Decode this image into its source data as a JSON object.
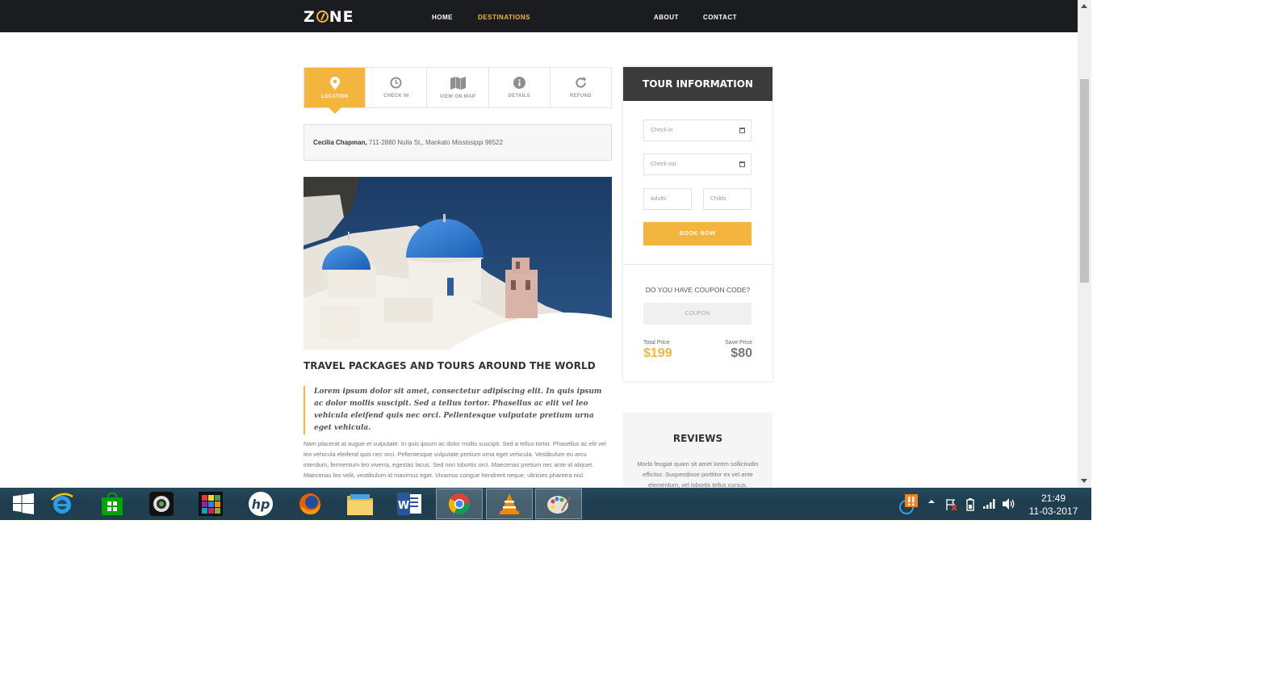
{
  "site": {
    "logo": "ZONE",
    "logo_left": "Z",
    "logo_right": "NE",
    "nav": {
      "home": "HOME",
      "destinations": "DESTINATIONS",
      "about": "ABOUT",
      "contact": "CONTACT"
    }
  },
  "tabs": [
    {
      "label": "LOCATION",
      "icon": "map-pin-icon",
      "active": true
    },
    {
      "label": "CHECK IN",
      "icon": "clock-icon",
      "active": false
    },
    {
      "label": "VIEW ON MAP",
      "icon": "map-icon",
      "active": false
    },
    {
      "label": "DETAILS",
      "icon": "info-icon",
      "active": false
    },
    {
      "label": "REFUND",
      "icon": "refresh-icon",
      "active": false
    }
  ],
  "address": {
    "name": "Cecilia Chapman,",
    "street": " 711-2880 Nulla St., Mankato Mississippi 96522"
  },
  "content": {
    "heading": "TRAVEL PACKAGES AND TOURS AROUND THE WORLD",
    "quote": "Lorem ipsum dolor sit amet, consectetur adipiscing elit. In quis ipsum ac dolor mollis suscipit. Sed a tellus tortor. Phasellus ac elit vel leo vehicula eleifend quis nec orci. Pellentesque vulputate pretium urna eget vehicula.",
    "body": "Nam placerat at augue et vulputate. In quis ipsum ac dolor mollis suscipit. Sed a tellus tortor. Phasellus ac elit vel leo vehicula eleifend quis nec orci. Pellentesque vulputate pretium urna eget vehicula. Vestibulum eu arcu interdum, fermentum leo viverra, egestas lacus. Sed non lobortis orci. Maecenas pretium nec ante id aliquet. Maecenas leo velit, vestibulum id maximus eget. Vivamus congue hendrerit neque, ultricies pharetra nisl."
  },
  "tour": {
    "title": "TOUR INFORMATION",
    "checkin_placeholder": "Check in",
    "checkout_placeholder": "Check out",
    "adults_placeholder": "Adults",
    "childs_placeholder": "Childs",
    "book_label": "BOOK NOW",
    "coupon_question": "DO YOU HAVE COUPON CODE?",
    "coupon_placeholder": "COUPON",
    "total_label": "Total Price",
    "total_value": "$199",
    "save_label": "Save Price",
    "save_value": "$80"
  },
  "reviews": {
    "title": "REVIEWS",
    "text": "Morbi feugiat quam sit amet lorem sollicitudin efficitur. Suspendisse porttitor ex vel ante elementum, vel lobortis tellus cursus."
  },
  "colors": {
    "accent": "#f4b53f",
    "nav_bg": "#1b1c20",
    "panel_header": "#3c3b3b"
  },
  "taskbar": {
    "apps": [
      "windows-start-icon",
      "internet-explorer-icon",
      "store-icon",
      "webcam-icon",
      "photo-app-icon",
      "hp-icon",
      "firefox-icon",
      "file-explorer-icon",
      "word-icon",
      "chrome-icon",
      "vlc-icon",
      "paint-icon"
    ],
    "time": "21:49",
    "date": "11-03-2017"
  }
}
